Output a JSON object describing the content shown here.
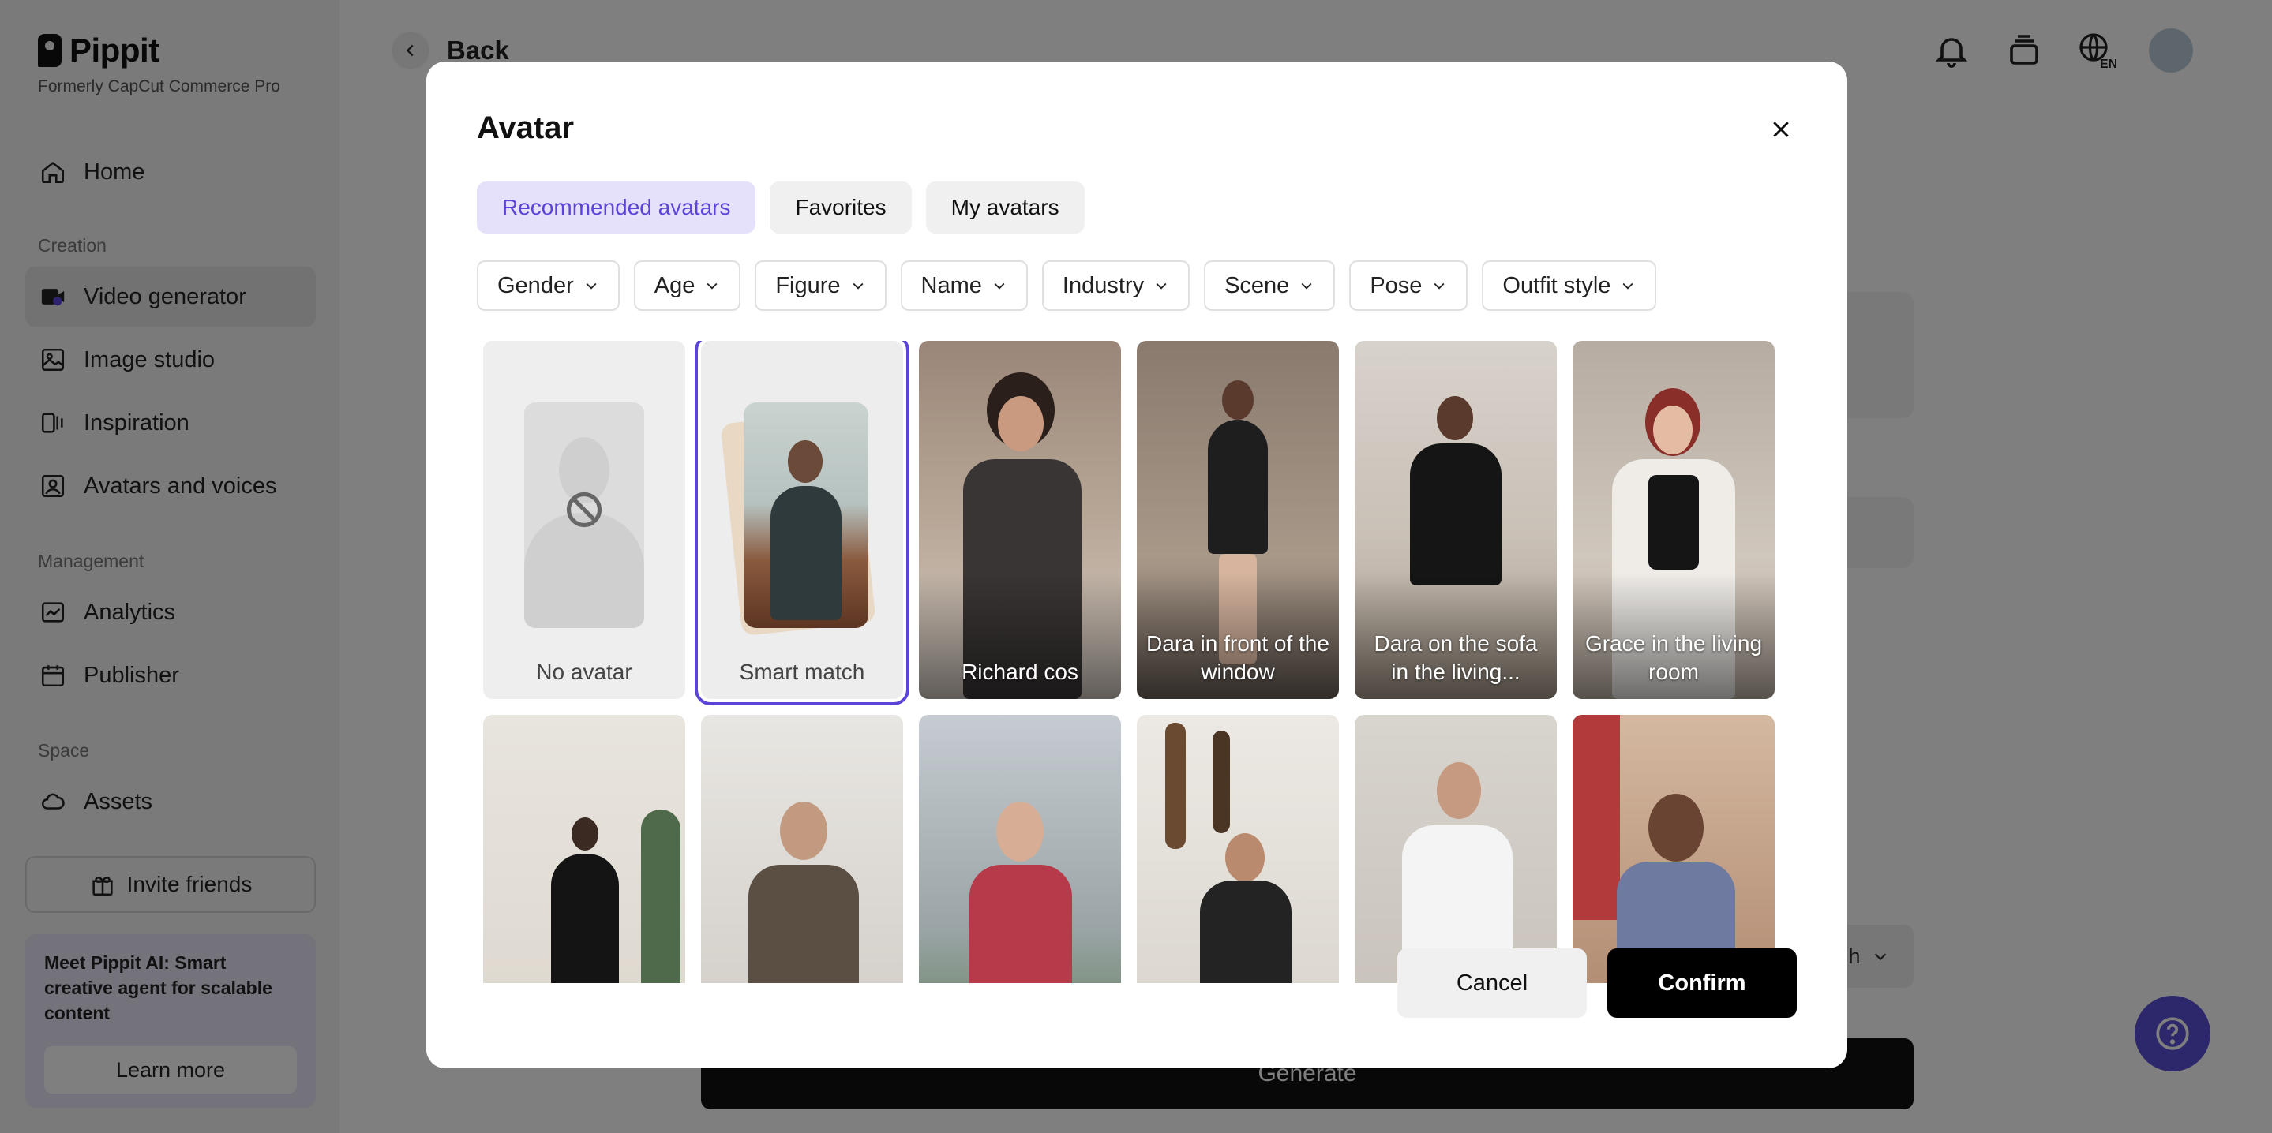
{
  "app": {
    "logo_text": "Pippit",
    "logo_subtitle": "Formerly CapCut Commerce Pro",
    "back_label": "Back"
  },
  "sidebar": {
    "items_top": [
      {
        "label": "Home",
        "icon": "home-icon"
      }
    ],
    "sections": [
      {
        "label": "Creation",
        "items": [
          {
            "label": "Video generator",
            "icon": "video-icon",
            "active": true
          },
          {
            "label": "Image studio",
            "icon": "image-icon"
          },
          {
            "label": "Inspiration",
            "icon": "inspiration-icon"
          },
          {
            "label": "Avatars and voices",
            "icon": "avatar-icon"
          }
        ]
      },
      {
        "label": "Management",
        "items": [
          {
            "label": "Analytics",
            "icon": "analytics-icon"
          },
          {
            "label": "Publisher",
            "icon": "calendar-icon"
          }
        ]
      },
      {
        "label": "Space",
        "items": [
          {
            "label": "Assets",
            "icon": "cloud-icon"
          }
        ]
      }
    ],
    "invite_label": "Invite friends",
    "promo_text": "Meet Pippit AI: Smart creative agent for scalable content",
    "promo_button": "Learn more"
  },
  "main": {
    "generate_label": "Generate",
    "select_suffix": "h"
  },
  "modal": {
    "title": "Avatar",
    "tabs": [
      {
        "label": "Recommended avatars",
        "active": true
      },
      {
        "label": "Favorites",
        "active": false
      },
      {
        "label": "My avatars",
        "active": false
      }
    ],
    "filters": [
      "Gender",
      "Age",
      "Figure",
      "Name",
      "Industry",
      "Scene",
      "Pose",
      "Outfit style"
    ],
    "avatars_row1": [
      {
        "label": "No avatar"
      },
      {
        "label": "Smart match",
        "selected": true
      },
      {
        "label": "Richard cos"
      },
      {
        "label": "Dara in front of the window"
      },
      {
        "label": "Dara on the sofa in the living..."
      },
      {
        "label": "Grace in the living room"
      }
    ],
    "cancel_label": "Cancel",
    "confirm_label": "Confirm"
  },
  "colors": {
    "accent": "#5a45d8",
    "accent_light": "#e6e1fb",
    "overlay": "rgba(0,0,0,0.5)"
  }
}
